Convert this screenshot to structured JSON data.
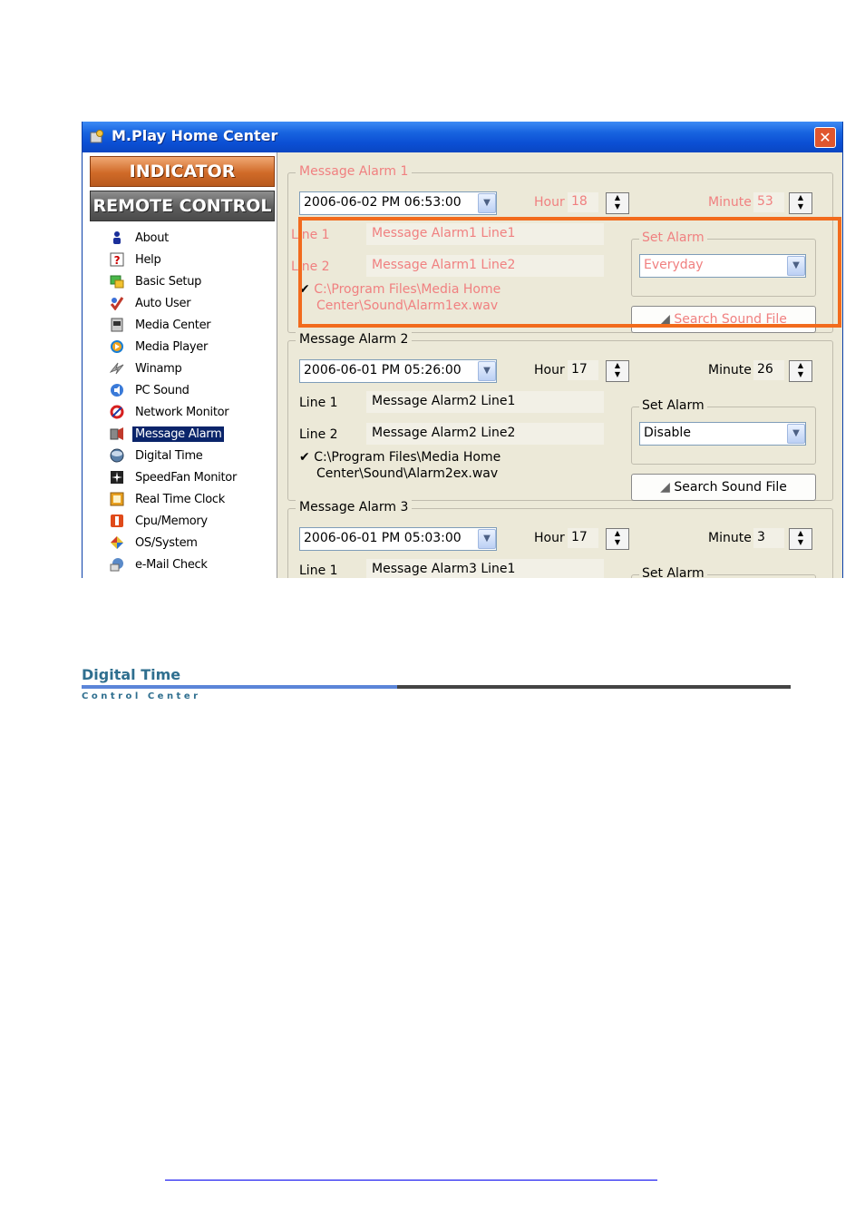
{
  "window": {
    "title": "M.Play Home Center",
    "close_glyph": "✕"
  },
  "left_panel": {
    "indicator_label": "INDICATOR",
    "remote_label": "REMOTE CONTROL",
    "nav": [
      {
        "label": "About",
        "icon": "about-icon"
      },
      {
        "label": "Help",
        "icon": "help-icon"
      },
      {
        "label": "Basic Setup",
        "icon": "basic-setup-icon"
      },
      {
        "label": "Auto User",
        "icon": "auto-user-icon"
      },
      {
        "label": "Media Center",
        "icon": "media-center-icon"
      },
      {
        "label": "Media Player",
        "icon": "media-player-icon"
      },
      {
        "label": "Winamp",
        "icon": "winamp-icon"
      },
      {
        "label": "PC Sound",
        "icon": "pc-sound-icon"
      },
      {
        "label": "Network Monitor",
        "icon": "network-monitor-icon"
      },
      {
        "label": "Message Alarm",
        "icon": "message-alarm-icon",
        "selected": true
      },
      {
        "label": "Digital Time",
        "icon": "digital-time-icon"
      },
      {
        "label": "SpeedFan Monitor",
        "icon": "speedfan-monitor-icon"
      },
      {
        "label": "Real Time Clock",
        "icon": "real-time-clock-icon"
      },
      {
        "label": "Cpu/Memory",
        "icon": "cpu-memory-icon"
      },
      {
        "label": "OS/System",
        "icon": "os-system-icon"
      },
      {
        "label": "e-Mail Check",
        "icon": "email-check-icon"
      }
    ]
  },
  "alarms": [
    {
      "title": "Message Alarm 1",
      "datetime": "2006-06-02  PM 06:53:00",
      "hour_label": "Hour",
      "hour": "18",
      "minute_label": "Minute",
      "minute": "53",
      "line1_label": "Line 1",
      "line1": "Message Alarm1 Line1",
      "line2_label": "Line 2",
      "line2": "Message Alarm1 Line2",
      "sound_path_1": "C:\\Program Files\\Media Home",
      "sound_path_2": "Center\\Sound\\Alarm1ex.wav",
      "set_alarm_label": "Set Alarm",
      "set_alarm_value": "Everyday",
      "search_label": "Search Sound File"
    },
    {
      "title": "Message Alarm 2",
      "datetime": "2006-06-01  PM 05:26:00",
      "hour_label": "Hour",
      "hour": "17",
      "minute_label": "Minute",
      "minute": "26",
      "line1_label": "Line 1",
      "line1": "Message Alarm2 Line1",
      "line2_label": "Line 2",
      "line2": "Message Alarm2 Line2",
      "sound_path_1": "C:\\Program Files\\Media Home",
      "sound_path_2": "Center\\Sound\\Alarm2ex.wav",
      "set_alarm_label": "Set Alarm",
      "set_alarm_value": "Disable",
      "search_label": "Search Sound File"
    },
    {
      "title": "Message Alarm 3",
      "datetime": "2006-06-01  PM 05:03:00",
      "hour_label": "Hour",
      "hour": "17",
      "minute_label": "Minute",
      "minute": "3",
      "line1_label": "Line 1",
      "line1": "Message Alarm3 Line1",
      "set_alarm_label": "Set Alarm"
    }
  ],
  "logo": {
    "title": "Digital Time",
    "subtitle": "Control Center"
  },
  "colors": {
    "highlight": "#f26b1d",
    "selection": "#0a246a",
    "title_bar": "#0b4fd4"
  }
}
